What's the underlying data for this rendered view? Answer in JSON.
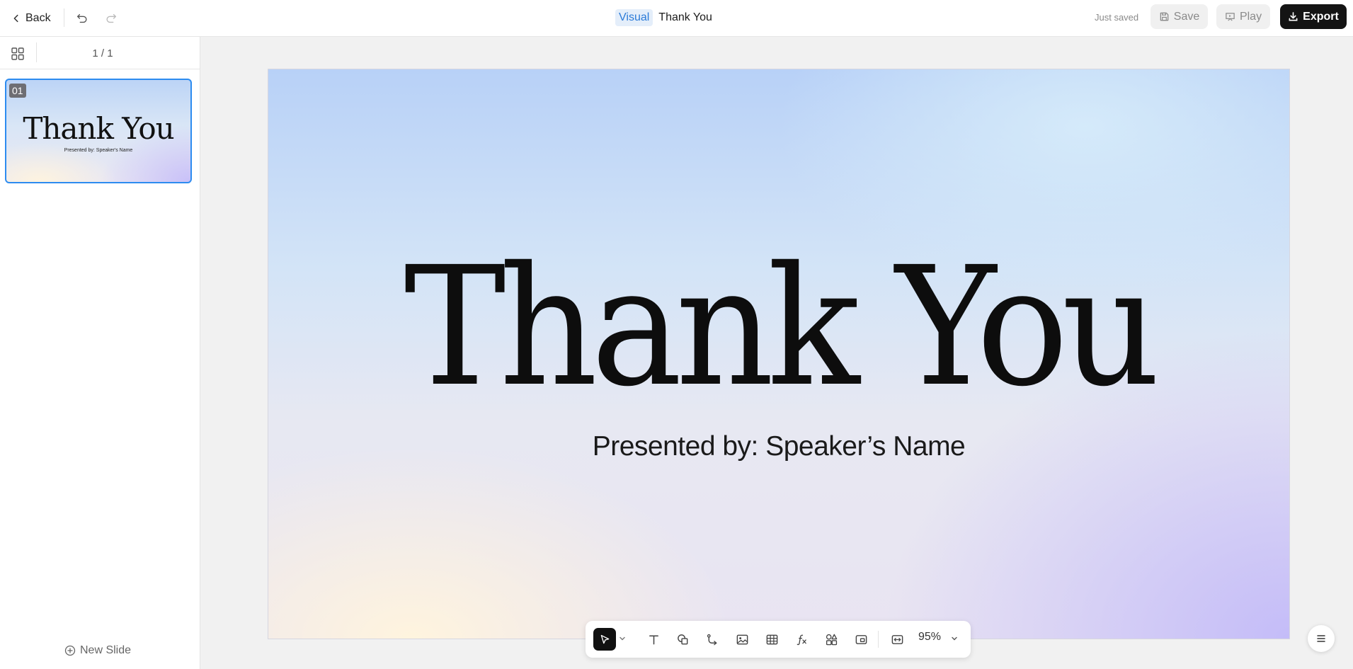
{
  "header": {
    "back_label": "Back",
    "mode_label": "Visual",
    "doc_title": "Thank You",
    "save_status": "Just saved",
    "save_label": "Save",
    "play_label": "Play",
    "export_label": "Export",
    "icons": [
      "chevron-left-icon",
      "undo-icon",
      "redo-icon",
      "save-icon",
      "play-icon",
      "download-icon"
    ]
  },
  "sidebar": {
    "page_indicator": "1 / 1",
    "slides": [
      {
        "number": "01",
        "title": "Thank You",
        "subtitle": "Presented by: Speaker's Name"
      }
    ],
    "new_slide_label": "New Slide"
  },
  "slide": {
    "title": "Thank You",
    "subtitle": "Presented by: Speaker’s Name"
  },
  "toolbar": {
    "tools": [
      "select",
      "text",
      "shape",
      "connector",
      "image",
      "table",
      "formula",
      "components",
      "media",
      "fit-width"
    ],
    "zoom": "95%"
  },
  "colors": {
    "accent": "#2d8cf0",
    "badge_bg": "#e4eefa",
    "badge_text": "#2b7bd8",
    "export_bg": "#141414"
  }
}
